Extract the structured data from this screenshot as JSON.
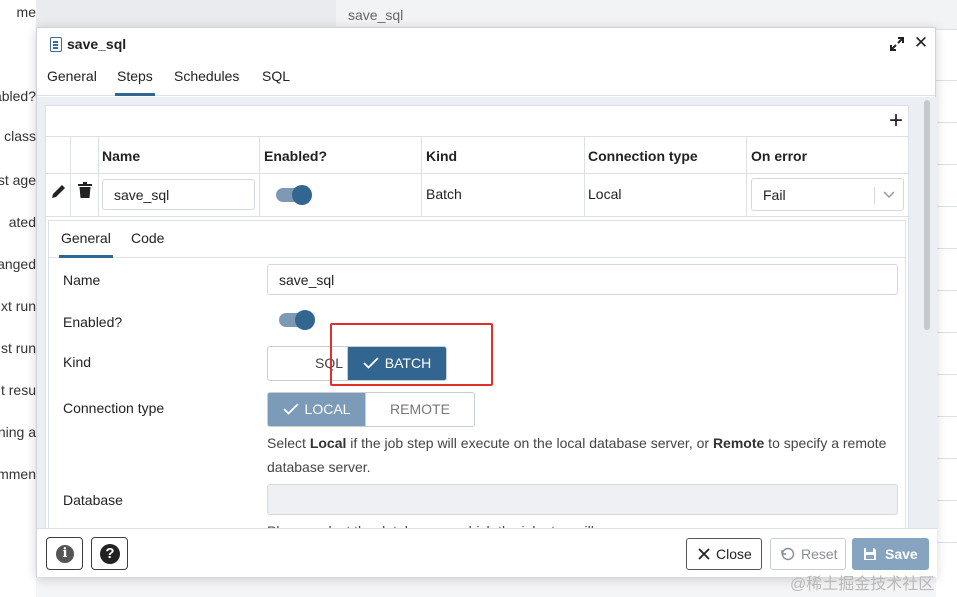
{
  "background": {
    "left_fragments": [
      "me",
      "abled?",
      "o class",
      "st age",
      "ated",
      "anged",
      "xt run",
      "st run",
      "t resu",
      "ning a",
      "mmen"
    ],
    "top_tab_text": "save_sql",
    "watermark": "@稀土掘金技术社区"
  },
  "dialog": {
    "title": "save_sql",
    "tabs": [
      "General",
      "Steps",
      "Schedules",
      "SQL"
    ],
    "active_tab": "Steps"
  },
  "grid": {
    "headers": [
      "Name",
      "Enabled?",
      "Kind",
      "Connection type",
      "On error"
    ],
    "row": {
      "name": "save_sql",
      "enabled": true,
      "kind": "Batch",
      "connection_type": "Local",
      "on_error": "Fail"
    }
  },
  "detail": {
    "sub_tabs": [
      "General",
      "Code"
    ],
    "active_sub_tab": "General",
    "labels": {
      "name": "Name",
      "enabled": "Enabled?",
      "kind": "Kind",
      "connection_type": "Connection type",
      "database": "Database"
    },
    "name_value": "save_sql",
    "enabled": true,
    "kind_options": [
      "SQL",
      "BATCH"
    ],
    "kind_selected": "BATCH",
    "connection_options": [
      "LOCAL",
      "REMOTE"
    ],
    "connection_selected": "LOCAL",
    "connection_help": {
      "pre": "Select ",
      "local": "Local",
      "mid": " if the job step will execute on the local database server, or ",
      "remote": "Remote",
      "post": " to specify a remote database server."
    },
    "database_value": "",
    "database_help": "Please select the database on which the job step will run."
  },
  "footer": {
    "info_glyph": "i",
    "help_glyph": "?",
    "close_label": "Close",
    "reset_label": "Reset",
    "save_label": "Save"
  },
  "colors": {
    "accent": "#326690",
    "highlight_box": "#e0302b",
    "save_button": "#86a4c0"
  },
  "icons": [
    "calendar-list-icon",
    "maximize-icon",
    "close-icon",
    "plus-icon",
    "pencil-icon",
    "trash-icon",
    "chevron-down-icon",
    "check-icon",
    "info-icon",
    "question-icon",
    "x-icon",
    "reset-icon",
    "floppy-icon"
  ]
}
